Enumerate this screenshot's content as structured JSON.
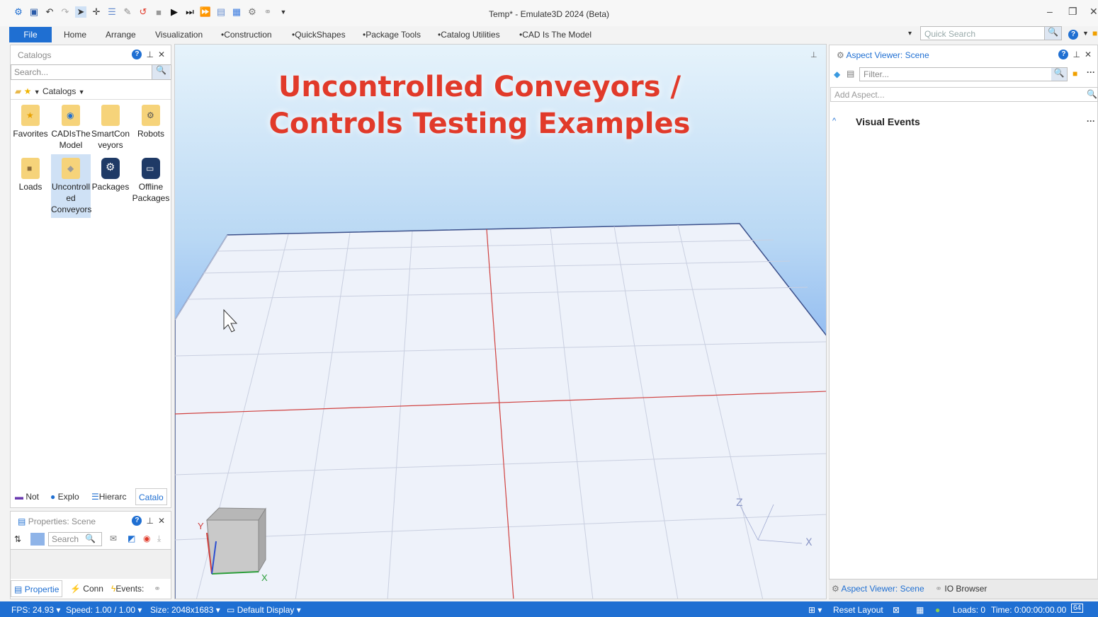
{
  "window": {
    "title": "Temp* - Emulate3D 2024 (Beta)"
  },
  "ribbon": {
    "file_label": "File",
    "tabs": [
      "Home",
      "Arrange",
      "Visualization",
      "•Construction",
      "•QuickShapes",
      "•Package Tools",
      "•Catalog Utilities",
      "•CAD Is The Model"
    ],
    "quick_search_placeholder": "Quick Search"
  },
  "catalogs": {
    "title": "Catalogs",
    "search_placeholder": "Search...",
    "toolbar_label": "Catalogs",
    "items": [
      {
        "label": "Favorites",
        "icon": "favorites-folder-icon"
      },
      {
        "label": "CADIsThe Model",
        "icon": "cad-catalog-icon"
      },
      {
        "label": "SmartCon veyors",
        "icon": "folder-icon"
      },
      {
        "label": "Robots",
        "icon": "robots-catalog-icon"
      },
      {
        "label": "Loads",
        "icon": "loads-catalog-icon"
      },
      {
        "label": "Uncontroll ed Conveyors",
        "icon": "uncontrolled-conveyors-icon",
        "selected": true
      },
      {
        "label": "Packages",
        "icon": "packages-icon"
      },
      {
        "label": "Offline Packages",
        "icon": "offline-packages-icon"
      }
    ],
    "bottom_tabs": [
      "Not",
      "Explo",
      "Hierarc",
      "Catalo"
    ]
  },
  "properties": {
    "title": "Properties: Scene",
    "search_placeholder": "Search",
    "bottom_tabs": [
      "Propertie",
      "Conn",
      "Events:"
    ]
  },
  "viewport": {
    "headline_line1": "Uncontrolled Conveyors /",
    "headline_line2": "Controls Testing Examples",
    "axis_labels": {
      "x": "X",
      "y": "Y",
      "z": "Z"
    }
  },
  "aspect_viewer": {
    "title": "Aspect Viewer: Scene",
    "filter_placeholder": "Filter...",
    "add_aspect_placeholder": "Add Aspect...",
    "section": "Visual Events",
    "bottom_tabs": [
      "Aspect Viewer: Scene",
      "IO Browser"
    ]
  },
  "status_bar": {
    "fps": "FPS: 24.93",
    "speed": "Speed: 1.00 / 1.00",
    "size": "Size: 2048x1683",
    "display": "Default Display",
    "reset_layout": "Reset Layout",
    "loads": "Loads: 0",
    "time": "Time: 0:00:00:00.00",
    "bits": "64"
  },
  "colors": {
    "accent": "#1f6fd2",
    "headline": "#e13a2a",
    "grid": "#c9cfe0",
    "axis_red": "#d0413f"
  }
}
